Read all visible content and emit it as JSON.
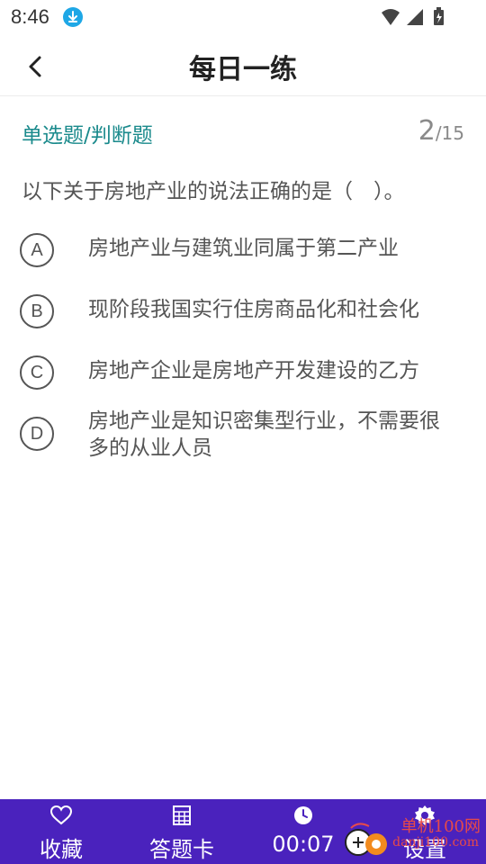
{
  "status_bar": {
    "time": "8:46",
    "download_icon": "download-icon"
  },
  "header": {
    "title": "每日一练"
  },
  "question": {
    "type_label": "单选题/判断题",
    "current": "2",
    "total": "/15",
    "text": "以下关于房地产业的说法正确的是（　）。"
  },
  "options": [
    {
      "letter": "A",
      "text": "房地产业与建筑业同属于第二产业"
    },
    {
      "letter": "B",
      "text": "现阶段我国实行住房商品化和社会化"
    },
    {
      "letter": "C",
      "text": "房地产企业是房地产开发建设的乙方"
    },
    {
      "letter": "D",
      "text": "房地产业是知识密集型行业，不需要很多的从业人员"
    }
  ],
  "bottom_bar": {
    "favorite_label": "收藏",
    "answer_card_label": "答题卡",
    "timer_label": "00:07",
    "settings_label": "设置"
  },
  "watermark": {
    "text": "单机100网",
    "sub": "danji100.com"
  },
  "colors": {
    "accent": "#1a8a8c",
    "bottom_bar": "#4a22bd"
  }
}
